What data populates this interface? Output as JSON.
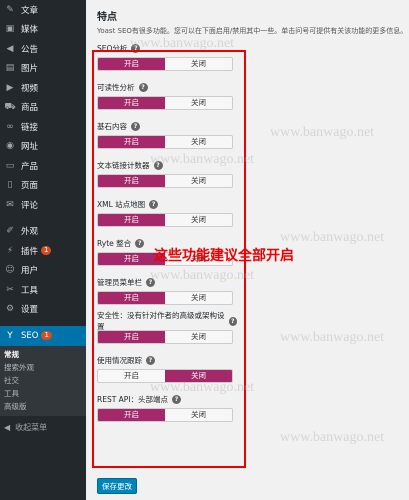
{
  "sidebar": {
    "items": [
      {
        "label": "文章",
        "icon": "pin-icon",
        "glyph": "✎"
      },
      {
        "label": "媒体",
        "icon": "media-icon",
        "glyph": "▣"
      },
      {
        "label": "公告",
        "icon": "megaphone-icon",
        "glyph": "◀"
      },
      {
        "label": "图片",
        "icon": "image-icon",
        "glyph": "▤"
      },
      {
        "label": "视频",
        "icon": "video-icon",
        "glyph": "▶"
      },
      {
        "label": "商品",
        "icon": "cart-icon",
        "glyph": "⛟"
      },
      {
        "label": "链接",
        "icon": "link-icon",
        "glyph": "∞"
      },
      {
        "label": "网址",
        "icon": "globe-icon",
        "glyph": "◉"
      },
      {
        "label": "产品",
        "icon": "folder-icon",
        "glyph": "▭"
      },
      {
        "label": "页面",
        "icon": "page-icon",
        "glyph": "▯"
      },
      {
        "label": "评论",
        "icon": "comment-icon",
        "glyph": "✉"
      }
    ],
    "items2": [
      {
        "label": "外观",
        "icon": "brush-icon",
        "glyph": "✐"
      },
      {
        "label": "插件",
        "icon": "plugin-icon",
        "glyph": "⚡",
        "badge": "1"
      },
      {
        "label": "用户",
        "icon": "user-icon",
        "glyph": "☺"
      },
      {
        "label": "工具",
        "icon": "wrench-icon",
        "glyph": "✂"
      },
      {
        "label": "设置",
        "icon": "settings-icon",
        "glyph": "⚙"
      }
    ],
    "seo": {
      "label": "SEO",
      "badge": "1",
      "icon": "yoast-icon",
      "glyph": "Y"
    },
    "submenu": [
      "常规",
      "搜索外观",
      "社交",
      "工具",
      "高级版"
    ],
    "collapse": "收起菜单"
  },
  "main": {
    "title": "特点",
    "intro": "Yoast SEO有很多功能。您可以在下面启用/禁用其中一些。单击问号可提供有关该功能的更多信息。",
    "on": "开启",
    "off": "关闭",
    "features": [
      {
        "label": "SEO分析",
        "state": "on"
      },
      {
        "label": "可读性分析",
        "state": "on"
      },
      {
        "label": "基石内容",
        "state": "on"
      },
      {
        "label": "文本链接计数器",
        "state": "on"
      },
      {
        "label": "XML 站点地图",
        "state": "on"
      },
      {
        "label": "Ryte 整合",
        "state": "on"
      },
      {
        "label": "管理员菜单栏",
        "state": "on"
      },
      {
        "label": "安全性：没有针对作者的高级或架构设置",
        "state": "on"
      },
      {
        "label": "使用情况跟踪",
        "state": "off"
      },
      {
        "label": "REST API：头部端点",
        "state": "on"
      }
    ],
    "save": "保存更改"
  },
  "annotation": "这些功能建议全部开启",
  "watermark": "www.banwago.net",
  "colors": {
    "accent": "#a4286a",
    "sidebar": "#23282d",
    "active": "#0073aa",
    "annotation": "#ee0000"
  }
}
